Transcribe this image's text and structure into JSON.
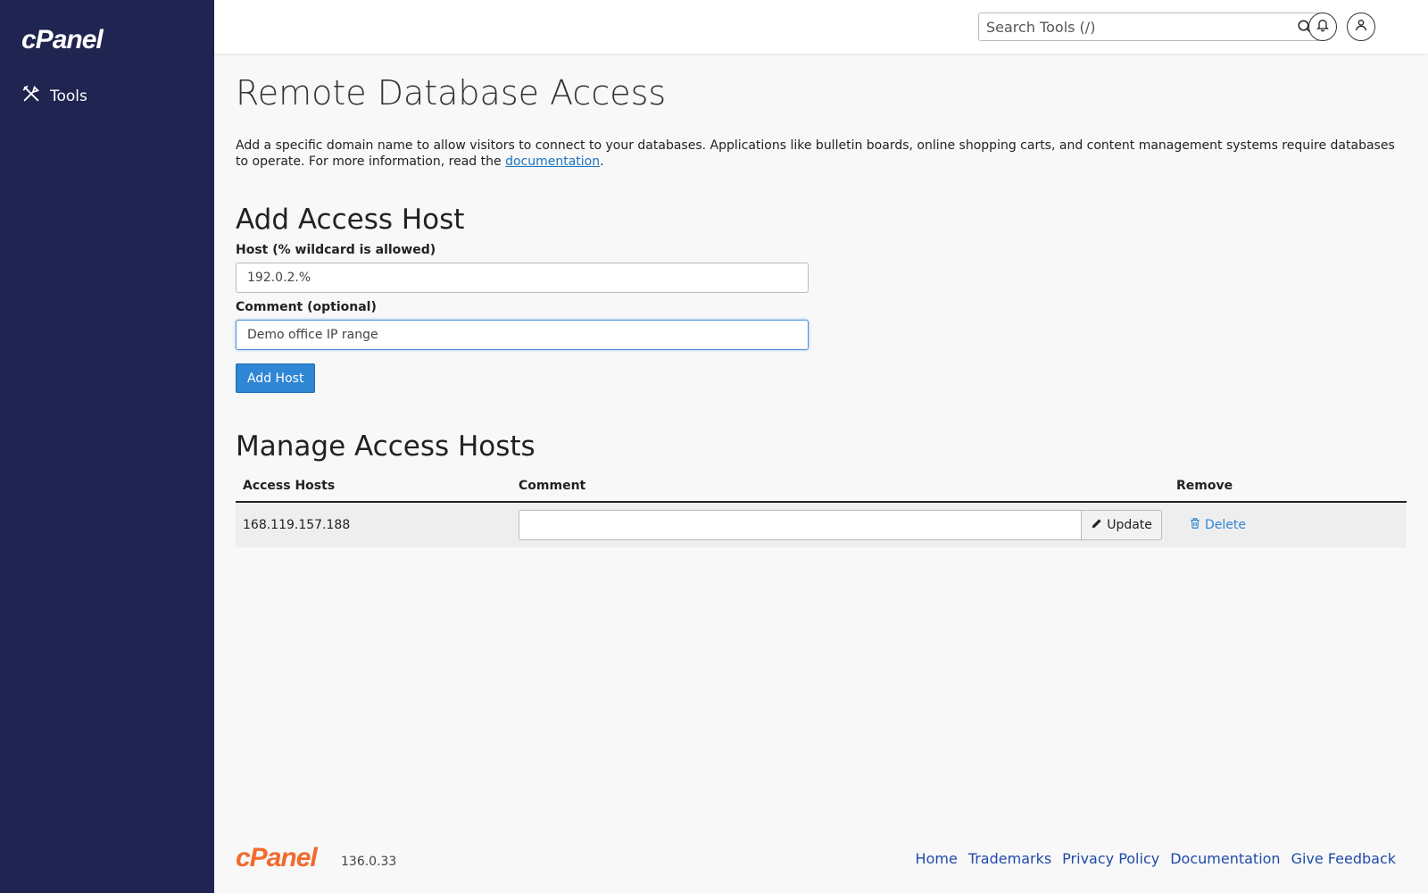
{
  "sidebar": {
    "brand": "cPanel",
    "items": [
      {
        "label": "Tools",
        "icon": "tools-icon"
      }
    ]
  },
  "header": {
    "search_placeholder": "Search Tools (/)",
    "search_icon": "search-icon",
    "notifications_icon": "bell-icon",
    "user_icon": "user-icon"
  },
  "main": {
    "title": "Remote Database Access",
    "description_before": "Add a specific domain name to allow visitors to connect to your databases. Applications like bulletin boards, online shopping carts, and content management systems require databases to operate. For more information, read the ",
    "description_link": "documentation",
    "description_after": ".",
    "add_section": {
      "heading": "Add Access Host",
      "host_label": "Host (% wildcard is allowed)",
      "host_value": "192.0.2.%",
      "comment_label": "Comment (optional)",
      "comment_value": "Demo office IP range",
      "submit_label": "Add Host"
    },
    "manage_section": {
      "heading": "Manage Access Hosts",
      "columns": [
        "Access Hosts",
        "Comment",
        "Remove"
      ],
      "rows": [
        {
          "host": "168.119.157.188",
          "comment": "",
          "update_label": "Update",
          "delete_label": "Delete"
        }
      ]
    }
  },
  "footer": {
    "logo": "cPanel",
    "version": "136.0.33",
    "links": [
      "Home",
      "Trademarks",
      "Privacy Policy",
      "Documentation",
      "Give Feedback"
    ]
  },
  "colors": {
    "sidebar_bg": "#1f2450",
    "primary": "#2f86d4",
    "footer_logo": "#f26a2e",
    "footer_link": "#1f4aa8"
  }
}
